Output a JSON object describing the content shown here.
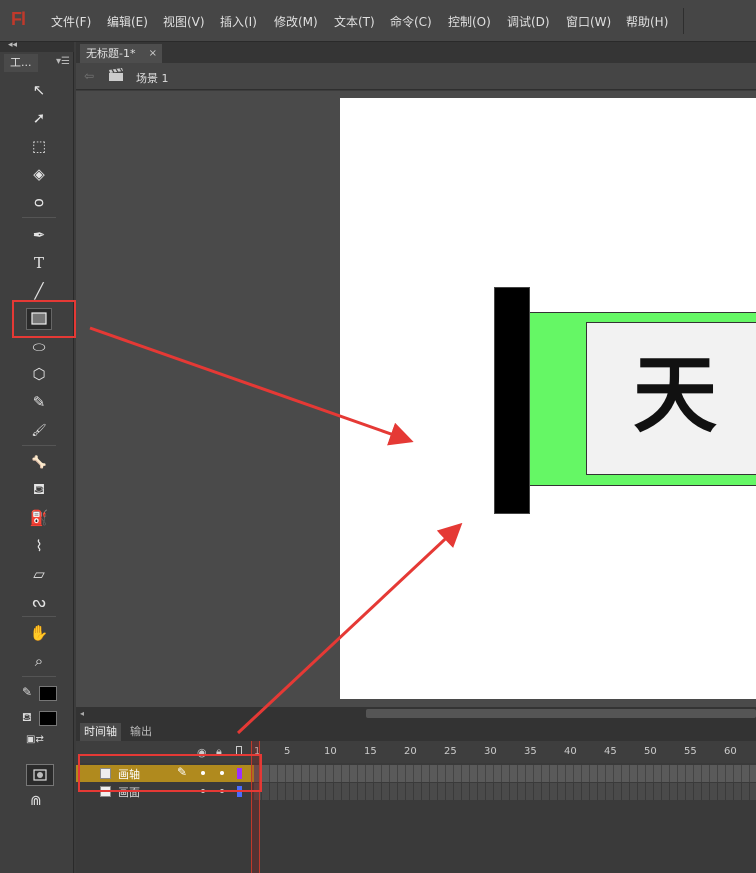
{
  "app": {
    "logo": "Fl"
  },
  "menu": [
    "文件(F)",
    "编辑(E)",
    "视图(V)",
    "插入(I)",
    "修改(M)",
    "文本(T)",
    "命令(C)",
    "控制(O)",
    "调试(D)",
    "窗口(W)",
    "帮助(H)"
  ],
  "toolbox": {
    "collapse_glyph": "◂◂",
    "tab_label": "工...",
    "menu_glyph": "▾☰",
    "tools": [
      {
        "name": "selection-tool",
        "glyph": "↖"
      },
      {
        "name": "subselection-tool",
        "glyph": "➚"
      },
      {
        "name": "free-transform-tool",
        "glyph": "⬚"
      },
      {
        "name": "3d-rotation-tool",
        "glyph": "◈"
      },
      {
        "name": "lasso-tool",
        "glyph": "ᴑ"
      },
      {
        "name": "pen-tool",
        "glyph": "✒"
      },
      {
        "name": "text-tool",
        "glyph": "T"
      },
      {
        "name": "line-tool",
        "glyph": "╱"
      },
      {
        "name": "rectangle-tool",
        "glyph": ""
      },
      {
        "name": "oval-tool",
        "glyph": "⬭"
      },
      {
        "name": "polystar-tool",
        "glyph": "⬡"
      },
      {
        "name": "pencil-tool",
        "glyph": "✎"
      },
      {
        "name": "brush-tool",
        "glyph": "🖌"
      },
      {
        "name": "bone-tool",
        "glyph": "🦴"
      },
      {
        "name": "paint-bucket-tool",
        "glyph": "⛾"
      },
      {
        "name": "ink-bottle-tool",
        "glyph": "⛽"
      },
      {
        "name": "eyedropper-tool",
        "glyph": "⌇"
      },
      {
        "name": "eraser-tool",
        "glyph": "▱"
      },
      {
        "name": "width-tool",
        "glyph": "ᔓ"
      },
      {
        "name": "hand-tool",
        "glyph": "✋"
      },
      {
        "name": "zoom-tool",
        "glyph": "⌕"
      }
    ],
    "stroke_color": "#000000",
    "fill_color": "#000000"
  },
  "document": {
    "tab_title": "无标题-1*",
    "tab_close": "×",
    "back_glyph": "⇦",
    "scene_label": "场景 1"
  },
  "stage": {
    "background": "#ffffff",
    "scroll_bar_color": "#65f765",
    "calligraphy_char": "天"
  },
  "timeline": {
    "tab_timeline": "时间轴",
    "tab_output": "输出",
    "frame_numbers": [
      "1",
      "5",
      "10",
      "15",
      "20",
      "25",
      "30",
      "35",
      "40",
      "45",
      "50",
      "55",
      "60"
    ],
    "layers": [
      {
        "name": "画轴",
        "selected": true
      },
      {
        "name": "画面",
        "selected": false
      }
    ]
  },
  "annotations": {
    "color": "#e53935"
  }
}
